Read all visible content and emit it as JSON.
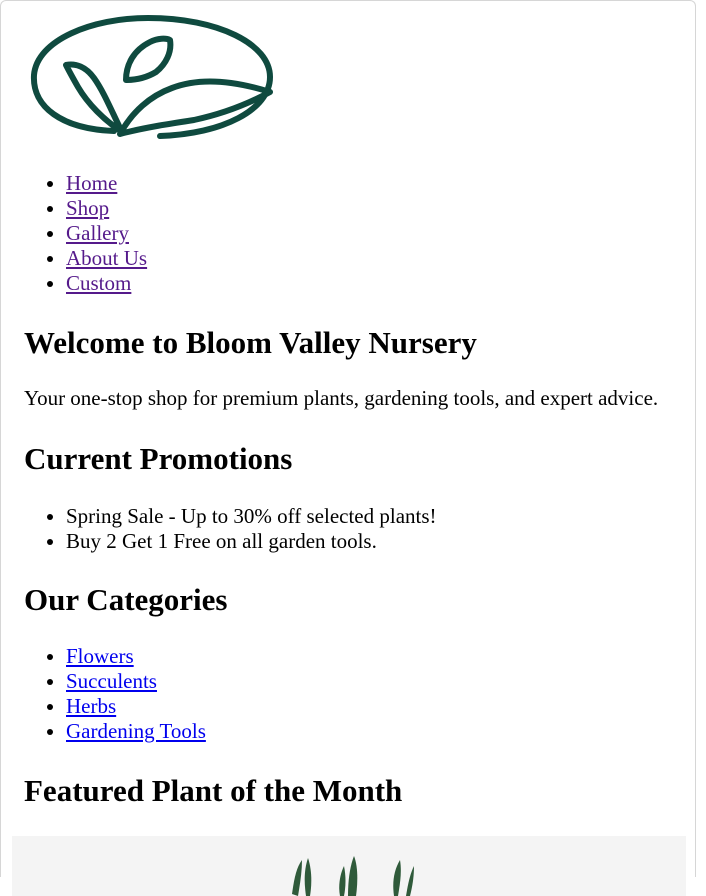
{
  "brand": {
    "logo_icon": "leaf-logo-icon",
    "color": "#0f4a3f"
  },
  "nav": {
    "items": [
      {
        "label": "Home"
      },
      {
        "label": "Shop"
      },
      {
        "label": "Gallery"
      },
      {
        "label": "About Us"
      },
      {
        "label": "Custom"
      }
    ]
  },
  "welcome": {
    "title": "Welcome to Bloom Valley Nursery",
    "text": "Your one-stop shop for premium plants, gardening tools, and expert advice."
  },
  "promotions": {
    "title": "Current Promotions",
    "items": [
      "Spring Sale - Up to 30% off selected plants!",
      "Buy 2 Get 1 Free on all garden tools."
    ]
  },
  "categories": {
    "title": "Our Categories",
    "items": [
      {
        "label": "Flowers"
      },
      {
        "label": "Succulents"
      },
      {
        "label": "Herbs"
      },
      {
        "label": "Gardening Tools"
      }
    ]
  },
  "featured": {
    "title": "Featured Plant of the Month",
    "image_icon": "plant-photo-icon"
  },
  "colors": {
    "link": "#0000ee",
    "visited_link": "#551a8b",
    "logo": "#0f4a3f"
  }
}
